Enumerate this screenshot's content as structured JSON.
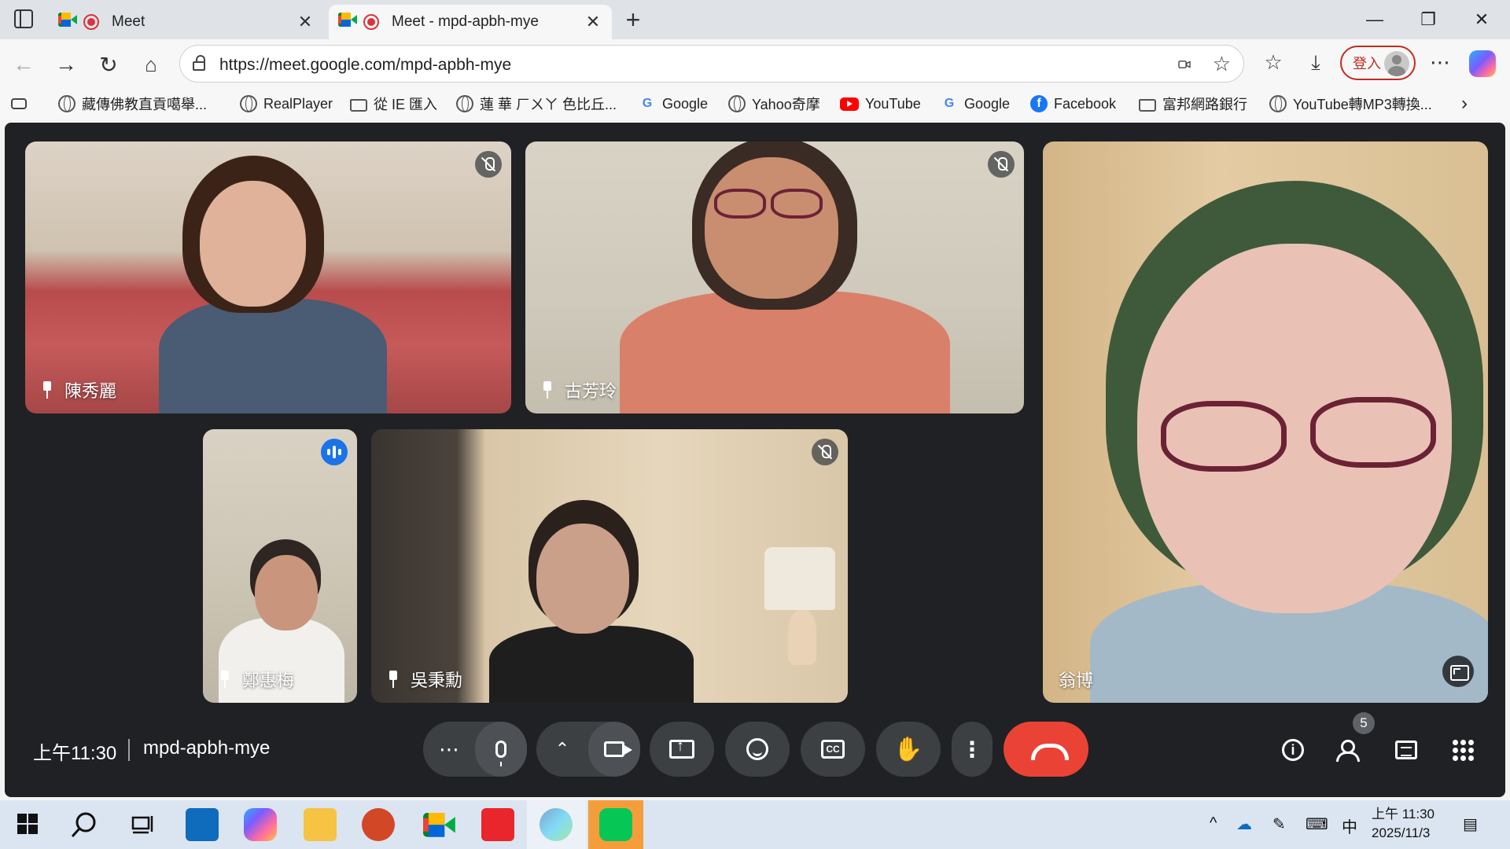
{
  "browser": {
    "tabs": [
      {
        "title": "Meet",
        "active": false
      },
      {
        "title": "Meet - mpd-apbh-mye",
        "active": true
      }
    ],
    "new_tab_label": "+",
    "window_controls": {
      "minimize": "—",
      "restore": "❐",
      "close": "✕"
    },
    "url": "https://meet.google.com/mpd-apbh-mye",
    "signin_label": "登入",
    "bookmarks": [
      {
        "label": "藏傳佛教直貢噶舉...",
        "icon": "globe-icon"
      },
      {
        "label": "RealPlayer",
        "icon": "globe-icon"
      },
      {
        "label": "從 IE 匯入",
        "icon": "folder-icon"
      },
      {
        "label": "蓮 華 ㄏㄨㄚ 色比丘...",
        "icon": "globe-icon"
      },
      {
        "label": "Google",
        "icon": "google-icon"
      },
      {
        "label": "Yahoo奇摩",
        "icon": "globe-icon"
      },
      {
        "label": "YouTube",
        "icon": "youtube-icon"
      },
      {
        "label": "Google",
        "icon": "google-icon"
      },
      {
        "label": "Facebook",
        "icon": "facebook-icon"
      },
      {
        "label": "富邦網路銀行",
        "icon": "folder-icon"
      },
      {
        "label": "YouTube轉MP3轉換...",
        "icon": "globe-icon"
      }
    ]
  },
  "meet": {
    "participants": [
      {
        "name": "陳秀麗",
        "muted": true,
        "pinned_icon": true
      },
      {
        "name": "古芳玲",
        "muted": true,
        "pinned_icon": true
      },
      {
        "name": "翁博",
        "muted": false,
        "pinned_icon": false
      },
      {
        "name": "鄭惠梅",
        "muted": false,
        "speaking": true,
        "pinned_icon": true
      },
      {
        "name": "吳秉勳",
        "muted": true,
        "pinned_icon": true
      }
    ],
    "time": "上午11:30",
    "meeting_code": "mpd-apbh-mye",
    "participant_count": "5",
    "colors": {
      "background": "#202124",
      "control": "#3c4043",
      "end_call": "#ea4335",
      "speaking": "#1a73e8"
    }
  },
  "taskbar": {
    "time": "上午 11:30",
    "date": "2025/11/3",
    "ime": "中"
  }
}
